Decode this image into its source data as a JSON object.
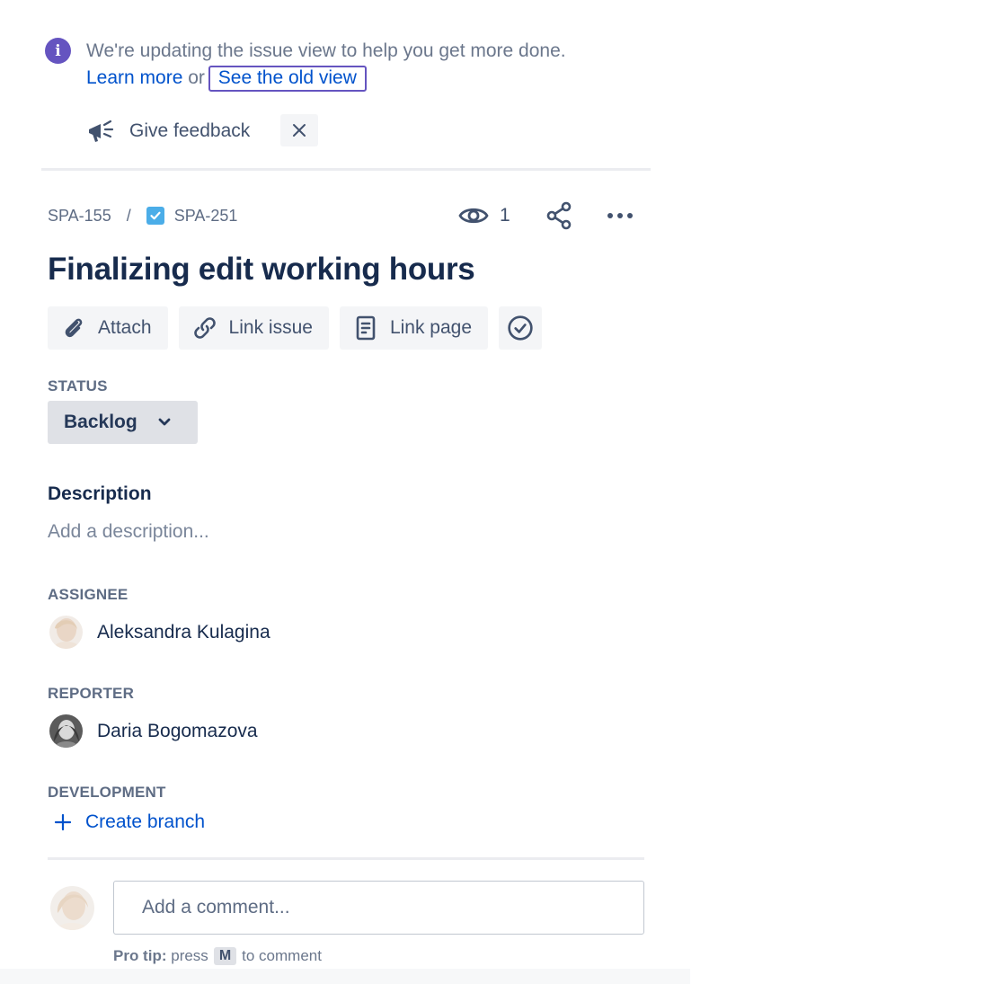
{
  "banner": {
    "text_prefix": "We're updating the issue view to help you get more done.",
    "learn_more": "Learn more",
    "or_text": "or",
    "old_view": "See the old view",
    "feedback": "Give feedback"
  },
  "breadcrumb": {
    "parent": "SPA-155",
    "separator": "/",
    "issue": "SPA-251"
  },
  "watchers": {
    "count": "1"
  },
  "issue": {
    "title": "Finalizing edit working hours"
  },
  "actions": {
    "attach": "Attach",
    "link_issue": "Link issue",
    "link_page": "Link page"
  },
  "status": {
    "label": "STATUS",
    "value": "Backlog"
  },
  "description": {
    "heading": "Description",
    "placeholder": "Add a description..."
  },
  "assignee": {
    "label": "ASSIGNEE",
    "name": "Aleksandra Kulagina"
  },
  "reporter": {
    "label": "REPORTER",
    "name": "Daria Bogomazova"
  },
  "development": {
    "label": "DEVELOPMENT",
    "create_branch": "Create branch"
  },
  "comment": {
    "placeholder": "Add a comment...",
    "protip_bold": "Pro tip:",
    "protip_press": "press",
    "protip_key": "M",
    "protip_suffix": "to comment"
  },
  "colors": {
    "accent": "#0052cc",
    "info": "#6554c0",
    "issue_type": "#4bade8"
  }
}
